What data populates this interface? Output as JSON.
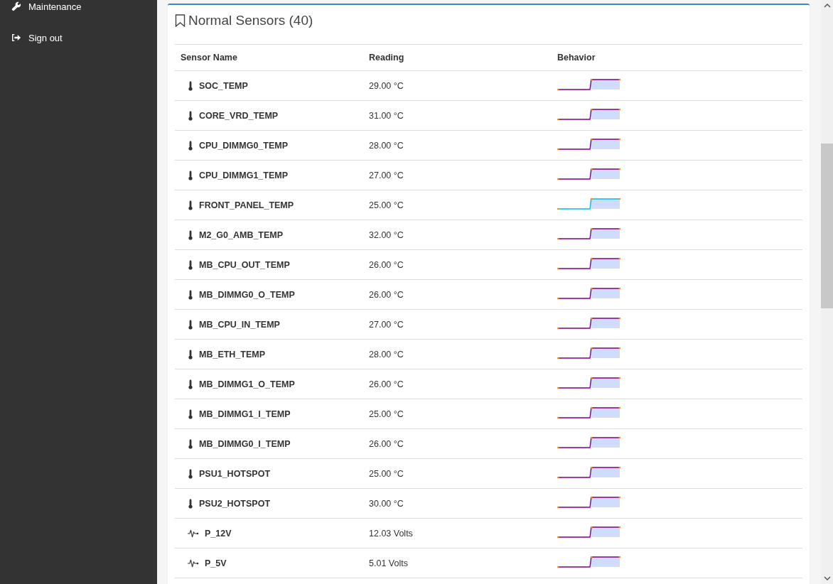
{
  "sidebar": {
    "items": [
      {
        "label": "Maintenance",
        "kind": "wrench"
      },
      {
        "label": "Sign out",
        "kind": "signout"
      }
    ]
  },
  "panel": {
    "title": "Normal Sensors (40)",
    "table": {
      "columns": [
        "Sensor Name",
        "Reading",
        "Behavior"
      ],
      "rows": [
        {
          "name": "SOC_TEMP",
          "reading": "29.00 °C",
          "kind": "temperature",
          "color": "#800080"
        },
        {
          "name": "CORE_VRD_TEMP",
          "reading": "31.00 °C",
          "kind": "temperature",
          "color": "#800080"
        },
        {
          "name": "CPU_DIMMG0_TEMP",
          "reading": "28.00 °C",
          "kind": "temperature",
          "color": "#800080"
        },
        {
          "name": "CPU_DIMMG1_TEMP",
          "reading": "27.00 °C",
          "kind": "temperature",
          "color": "#800080"
        },
        {
          "name": "FRONT_PANEL_TEMP",
          "reading": "25.00 °C",
          "kind": "temperature",
          "color": "#00bfe6"
        },
        {
          "name": "M2_G0_AMB_TEMP",
          "reading": "32.00 °C",
          "kind": "temperature",
          "color": "#800080"
        },
        {
          "name": "MB_CPU_OUT_TEMP",
          "reading": "26.00 °C",
          "kind": "temperature",
          "color": "#800080"
        },
        {
          "name": "MB_DIMMG0_O_TEMP",
          "reading": "26.00 °C",
          "kind": "temperature",
          "color": "#800080"
        },
        {
          "name": "MB_CPU_IN_TEMP",
          "reading": "27.00 °C",
          "kind": "temperature",
          "color": "#800080"
        },
        {
          "name": "MB_ETH_TEMP",
          "reading": "28.00 °C",
          "kind": "temperature",
          "color": "#800080"
        },
        {
          "name": "MB_DIMMG1_O_TEMP",
          "reading": "26.00 °C",
          "kind": "temperature",
          "color": "#800080"
        },
        {
          "name": "MB_DIMMG1_I_TEMP",
          "reading": "25.00 °C",
          "kind": "temperature",
          "color": "#800080"
        },
        {
          "name": "MB_DIMMG0_I_TEMP",
          "reading": "26.00 °C",
          "kind": "temperature",
          "color": "#800080"
        },
        {
          "name": "PSU1_HOTSPOT",
          "reading": "25.00 °C",
          "kind": "temperature",
          "color": "#800080"
        },
        {
          "name": "PSU2_HOTSPOT",
          "reading": "30.00 °C",
          "kind": "temperature",
          "color": "#800080"
        },
        {
          "name": "P_12V",
          "reading": "12.03 Volts",
          "kind": "voltage",
          "color": "#800080"
        },
        {
          "name": "P_5V",
          "reading": "5.01 Volts",
          "kind": "voltage",
          "color": "#800080"
        }
      ]
    }
  }
}
